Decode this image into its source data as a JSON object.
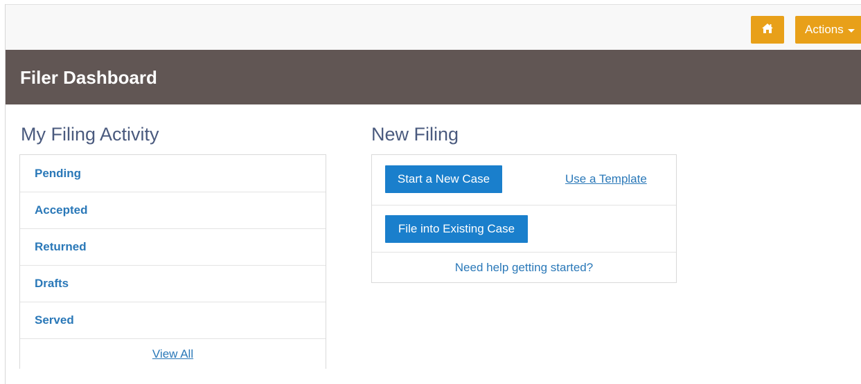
{
  "topbar": {
    "home_icon": "home-icon",
    "actions_label": "Actions",
    "accent_color": "#e8a019"
  },
  "header": {
    "title": "Filer Dashboard",
    "background_color": "#615654"
  },
  "activity": {
    "heading": "My Filing Activity",
    "items": [
      {
        "label": "Pending"
      },
      {
        "label": "Accepted"
      },
      {
        "label": "Returned"
      },
      {
        "label": "Drafts"
      },
      {
        "label": "Served"
      }
    ],
    "view_all_label": "View All"
  },
  "new_filing": {
    "heading": "New Filing",
    "start_case_label": "Start a New Case",
    "use_template_label": "Use a Template",
    "file_existing_label": "File into Existing Case",
    "help_label": "Need help getting started?",
    "button_color": "#1a7fcc"
  }
}
